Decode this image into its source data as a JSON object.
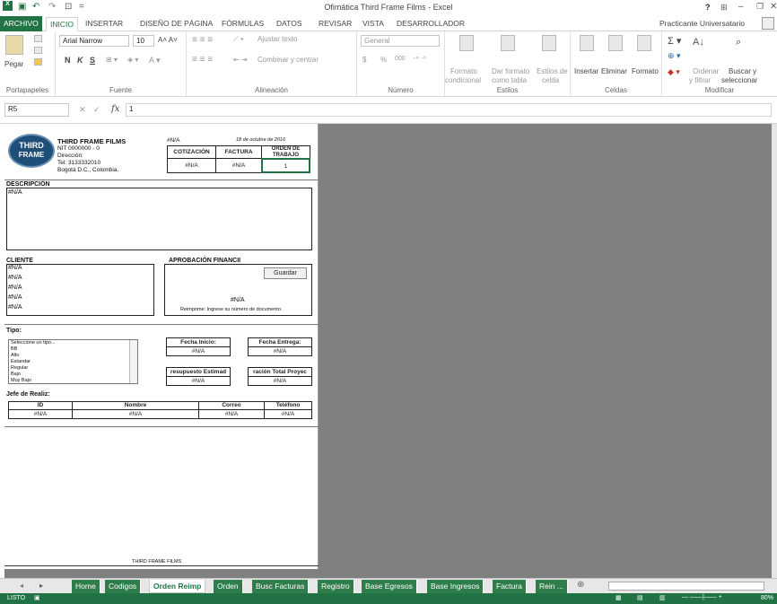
{
  "window": {
    "title": "Ofimática Third Frame Films - Excel",
    "help": "?",
    "user": "Practicante Universatario"
  },
  "tabs": [
    "ARCHIVO",
    "INICIO",
    "INSERTAR",
    "DISEÑO DE PÁGINA",
    "FÓRMULAS",
    "DATOS",
    "REVISAR",
    "VISTA",
    "DESARROLLADOR"
  ],
  "ribbon": {
    "paste": "Pegar",
    "clipboard": "Portapapeles",
    "font_name": "Arial Narrow",
    "font_size": "10",
    "bold": "N",
    "italic": "K",
    "underline": "S",
    "font_group": "Fuente",
    "wrap": "Ajustar texto",
    "merge": "Combinar y centrar",
    "align_group": "Alineación",
    "number_format": "General",
    "currency": "$",
    "percent": "%",
    "thousands": "000",
    "number_group": "Número",
    "cond_format": "Formato",
    "cond_format2": "condicional",
    "as_table": "Dar formato",
    "as_table2": "como tabla",
    "cell_styles": "Estilos de",
    "cell_styles2": "celda",
    "styles_group": "Estilos",
    "insert": "Insertar",
    "delete": "Eliminar",
    "format": "Formato",
    "cells_group": "Celdas",
    "sort": "Ordenar",
    "sort2": "y filtrar",
    "find": "Buscar y",
    "find2": "seleccionar",
    "modify_group": "Modificar"
  },
  "formula": {
    "namebox": "R5",
    "fx": "fx",
    "value": "1"
  },
  "doc": {
    "logo_line1": "THIRD",
    "logo_line2": "FRAME",
    "company": "THIRD FRAME FILMS",
    "nit": "NIT 0000000 - 0",
    "address": "Dirección:",
    "tel": "Tel: 3133332010",
    "city": "Bogotá D.C., Colombia.",
    "na": "#N/A",
    "date": "18 de octubre de 2016",
    "h_cot": "COTIZACIÓN",
    "h_fact": "FACTURA",
    "h_orden": "ORDEN DE TRABAJO",
    "orden_val": "1",
    "descripcion": "DESCRIPCIÓN",
    "cliente": "CLIENTE",
    "aprobacion": "APROBACIÓN FINANCII",
    "guardar": "Guardar",
    "reimprime": "Reimprime: Ingrese su número de documento.",
    "tipo": "Tipo:",
    "tipo_options": [
      "Seleccione un tipo...",
      "BB",
      "Alto",
      "Estandar",
      "Regular",
      "Bajo",
      "Muy Bajo"
    ],
    "fecha_inicio": "Fecha Inicio:",
    "fecha_entrega": "Fecha Entrega:",
    "presupuesto": "resupuesto Estimad",
    "duracion": "ración Total Proyec",
    "jefe": "Jefe de Realiz:",
    "c_id": "ID",
    "c_nombre": "Nombre",
    "c_correo": "Correo",
    "c_tel": "Teléfono",
    "footer": "THIRD FRAME FILMS"
  },
  "sheets": [
    "Home",
    "Codigos",
    "Orden Reimp",
    "Orden",
    "Busc Facturas",
    "Registro",
    "Base Egresos",
    "Base Ingresos",
    "Factura",
    "Rein ..."
  ],
  "status": {
    "left": "LISTO",
    "zoom": "80%"
  }
}
